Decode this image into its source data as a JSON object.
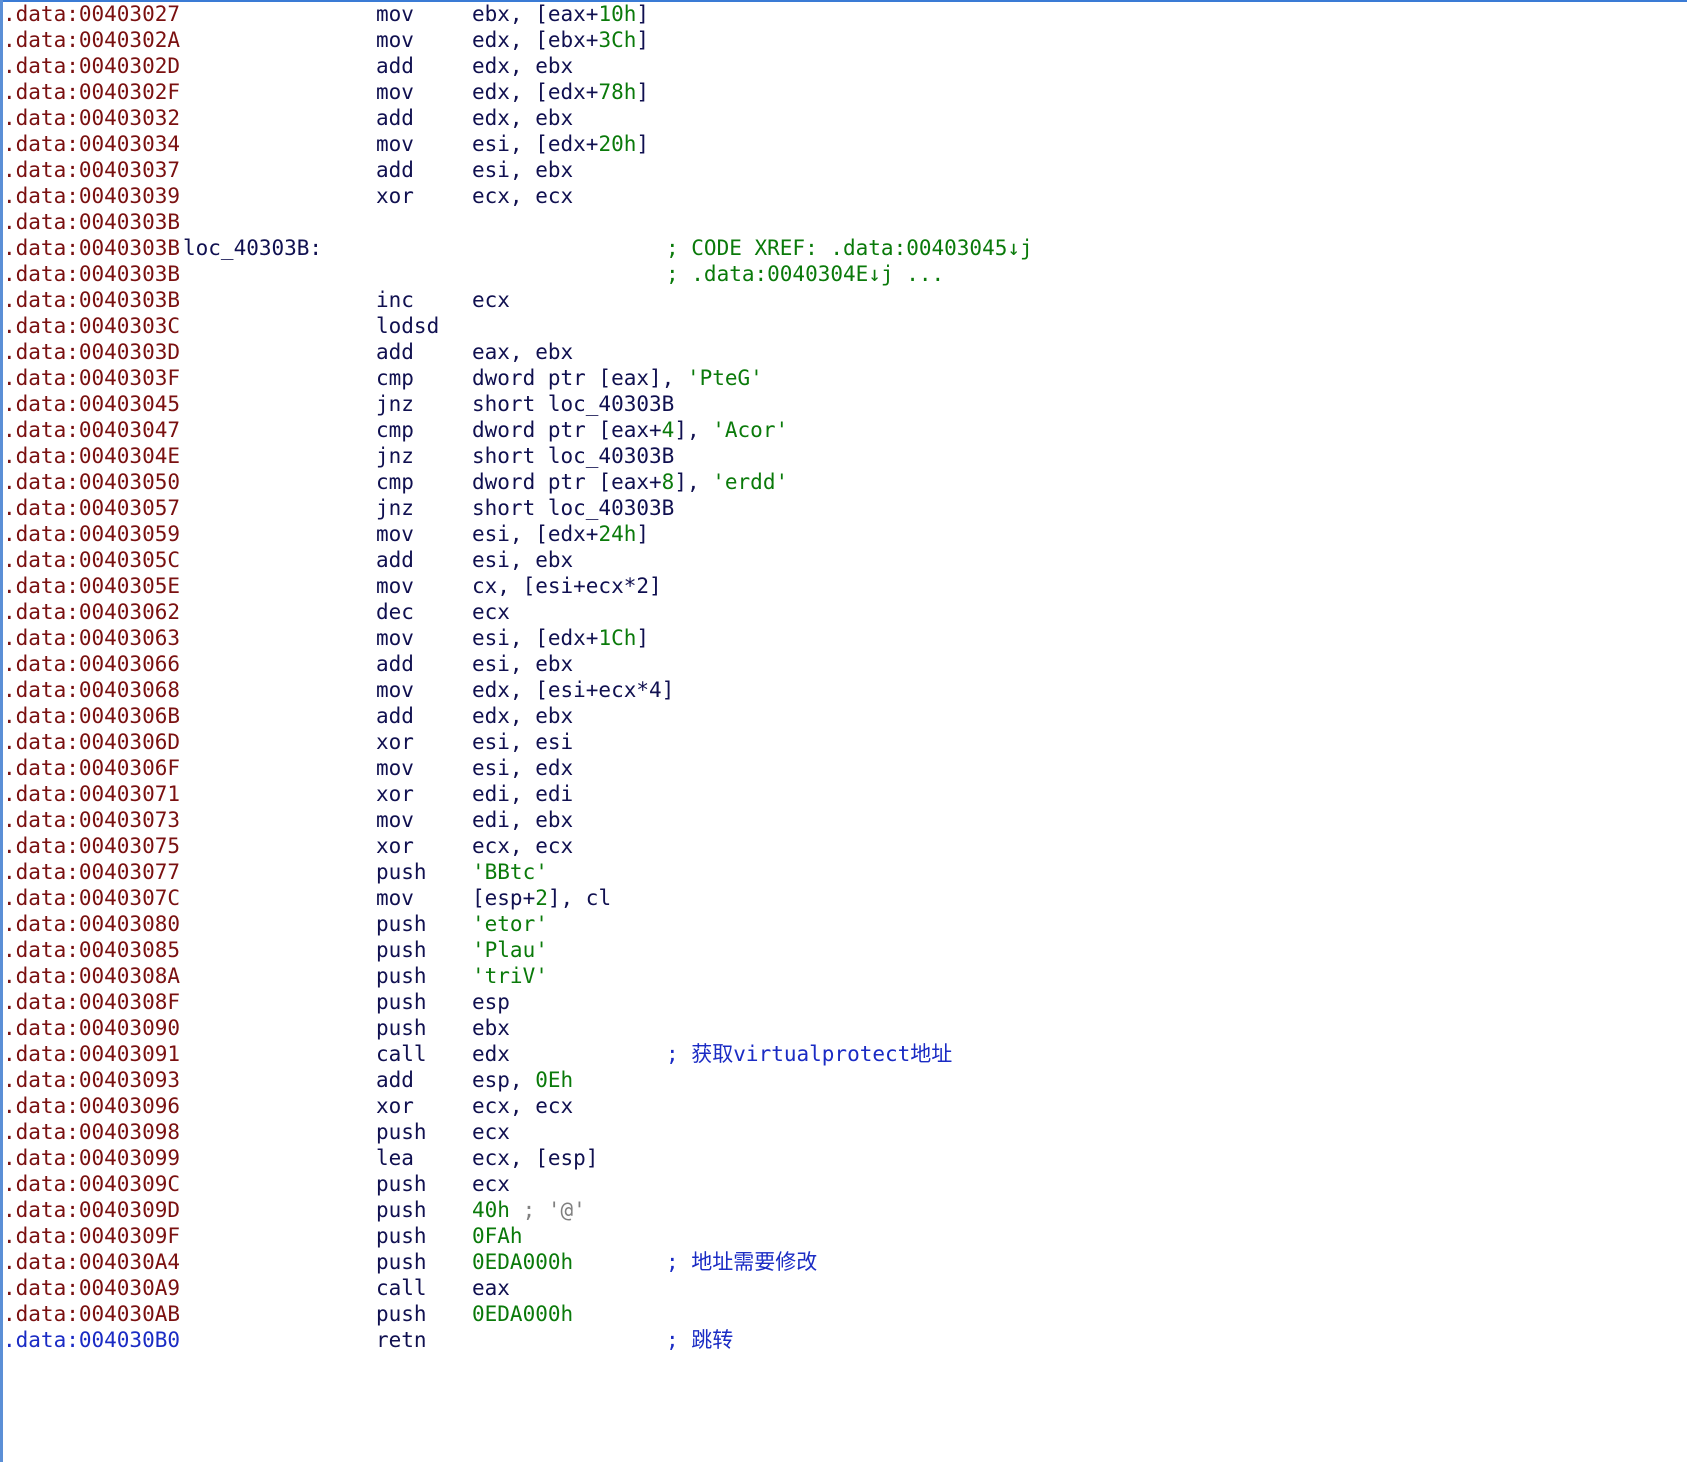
{
  "colors": {
    "address": "#7a1010",
    "current_address": "#1a2bc4",
    "text": "#101050",
    "number": "#0a7a0a",
    "comment": "#1a2bc4",
    "xref": "#0a7a0a",
    "edge": "#3a7bd5"
  },
  "lines": [
    {
      "addr": ".data:00403027",
      "mn": "mov",
      "op": [
        "ebx, [eax+",
        {
          "n": "10h"
        },
        "]"
      ]
    },
    {
      "addr": ".data:0040302A",
      "mn": "mov",
      "op": [
        "edx, [ebx+",
        {
          "n": "3Ch"
        },
        "]"
      ]
    },
    {
      "addr": ".data:0040302D",
      "mn": "add",
      "op": [
        "edx, ebx"
      ]
    },
    {
      "addr": ".data:0040302F",
      "mn": "mov",
      "op": [
        "edx, [edx+",
        {
          "n": "78h"
        },
        "]"
      ]
    },
    {
      "addr": ".data:00403032",
      "mn": "add",
      "op": [
        "edx, ebx"
      ]
    },
    {
      "addr": ".data:00403034",
      "mn": "mov",
      "op": [
        "esi, [edx+",
        {
          "n": "20h"
        },
        "]"
      ]
    },
    {
      "addr": ".data:00403037",
      "mn": "add",
      "op": [
        "esi, ebx"
      ]
    },
    {
      "addr": ".data:00403039",
      "mn": "xor",
      "op": [
        "ecx, ecx"
      ]
    },
    {
      "addr": ".data:0040303B"
    },
    {
      "addr": ".data:0040303B",
      "label": "loc_40303B:",
      "xref": "; CODE XREF: .data:00403045↓j"
    },
    {
      "addr": ".data:0040303B",
      "xref": "; .data:0040304E↓j ..."
    },
    {
      "addr": ".data:0040303B",
      "mn": "inc",
      "op": [
        "ecx"
      ]
    },
    {
      "addr": ".data:0040303C",
      "mn": "lodsd"
    },
    {
      "addr": ".data:0040303D",
      "mn": "add",
      "op": [
        "eax, ebx"
      ]
    },
    {
      "addr": ".data:0040303F",
      "mn": "cmp",
      "op": [
        "dword ptr [eax], ",
        {
          "n": "'PteG'"
        }
      ]
    },
    {
      "addr": ".data:00403045",
      "mn": "jnz",
      "op": [
        "short loc_40303B"
      ]
    },
    {
      "addr": ".data:00403047",
      "mn": "cmp",
      "op": [
        "dword ptr [eax+",
        {
          "n": "4"
        },
        "], ",
        {
          "n": "'Acor'"
        }
      ]
    },
    {
      "addr": ".data:0040304E",
      "mn": "jnz",
      "op": [
        "short loc_40303B"
      ]
    },
    {
      "addr": ".data:00403050",
      "mn": "cmp",
      "op": [
        "dword ptr [eax+",
        {
          "n": "8"
        },
        "], ",
        {
          "n": "'erdd'"
        }
      ]
    },
    {
      "addr": ".data:00403057",
      "mn": "jnz",
      "op": [
        "short loc_40303B"
      ]
    },
    {
      "addr": ".data:00403059",
      "mn": "mov",
      "op": [
        "esi, [edx+",
        {
          "n": "24h"
        },
        "]"
      ]
    },
    {
      "addr": ".data:0040305C",
      "mn": "add",
      "op": [
        "esi, ebx"
      ]
    },
    {
      "addr": ".data:0040305E",
      "mn": "mov",
      "op": [
        "cx, [esi+ecx*2]"
      ]
    },
    {
      "addr": ".data:00403062",
      "mn": "dec",
      "op": [
        "ecx"
      ]
    },
    {
      "addr": ".data:00403063",
      "mn": "mov",
      "op": [
        "esi, [edx+",
        {
          "n": "1Ch"
        },
        "]"
      ]
    },
    {
      "addr": ".data:00403066",
      "mn": "add",
      "op": [
        "esi, ebx"
      ]
    },
    {
      "addr": ".data:00403068",
      "mn": "mov",
      "op": [
        "edx, [esi+ecx*4]"
      ]
    },
    {
      "addr": ".data:0040306B",
      "mn": "add",
      "op": [
        "edx, ebx"
      ]
    },
    {
      "addr": ".data:0040306D",
      "mn": "xor",
      "op": [
        "esi, esi"
      ]
    },
    {
      "addr": ".data:0040306F",
      "mn": "mov",
      "op": [
        "esi, edx"
      ]
    },
    {
      "addr": ".data:00403071",
      "mn": "xor",
      "op": [
        "edi, edi"
      ]
    },
    {
      "addr": ".data:00403073",
      "mn": "mov",
      "op": [
        "edi, ebx"
      ]
    },
    {
      "addr": ".data:00403075",
      "mn": "xor",
      "op": [
        "ecx, ecx"
      ]
    },
    {
      "addr": ".data:00403077",
      "mn": "push",
      "op": [
        {
          "n": "'BBtc'"
        }
      ]
    },
    {
      "addr": ".data:0040307C",
      "mn": "mov",
      "op": [
        "[esp+",
        {
          "n": "2"
        },
        "], cl"
      ]
    },
    {
      "addr": ".data:00403080",
      "mn": "push",
      "op": [
        {
          "n": "'etor'"
        }
      ]
    },
    {
      "addr": ".data:00403085",
      "mn": "push",
      "op": [
        {
          "n": "'Plau'"
        }
      ]
    },
    {
      "addr": ".data:0040308A",
      "mn": "push",
      "op": [
        {
          "n": "'triV'"
        }
      ]
    },
    {
      "addr": ".data:0040308F",
      "mn": "push",
      "op": [
        "esp"
      ]
    },
    {
      "addr": ".data:00403090",
      "mn": "push",
      "op": [
        "ebx"
      ]
    },
    {
      "addr": ".data:00403091",
      "mn": "call",
      "op": [
        "edx"
      ],
      "comment": "; 获取virtualprotect地址"
    },
    {
      "addr": ".data:00403093",
      "mn": "add",
      "op": [
        "esp, ",
        {
          "n": "0Eh"
        }
      ]
    },
    {
      "addr": ".data:00403096",
      "mn": "xor",
      "op": [
        "ecx, ecx"
      ]
    },
    {
      "addr": ".data:00403098",
      "mn": "push",
      "op": [
        "ecx"
      ]
    },
    {
      "addr": ".data:00403099",
      "mn": "lea",
      "op": [
        "ecx, [esp]"
      ]
    },
    {
      "addr": ".data:0040309C",
      "mn": "push",
      "op": [
        "ecx"
      ]
    },
    {
      "addr": ".data:0040309D",
      "mn": "push",
      "op": [
        {
          "n": "40h"
        },
        {
          "g": " ; '@'"
        }
      ]
    },
    {
      "addr": ".data:0040309F",
      "mn": "push",
      "op": [
        {
          "n": "0FAh"
        }
      ]
    },
    {
      "addr": ".data:004030A4",
      "mn": "push",
      "op": [
        {
          "n": "0EDA000h"
        }
      ],
      "comment": "; 地址需要修改"
    },
    {
      "addr": ".data:004030A9",
      "mn": "call",
      "op": [
        "eax"
      ]
    },
    {
      "addr": ".data:004030AB",
      "mn": "push",
      "op": [
        {
          "n": "0EDA000h"
        }
      ]
    },
    {
      "addr": ".data:004030B0",
      "mn": "retn",
      "comment": "; 跳转",
      "current": true
    }
  ]
}
